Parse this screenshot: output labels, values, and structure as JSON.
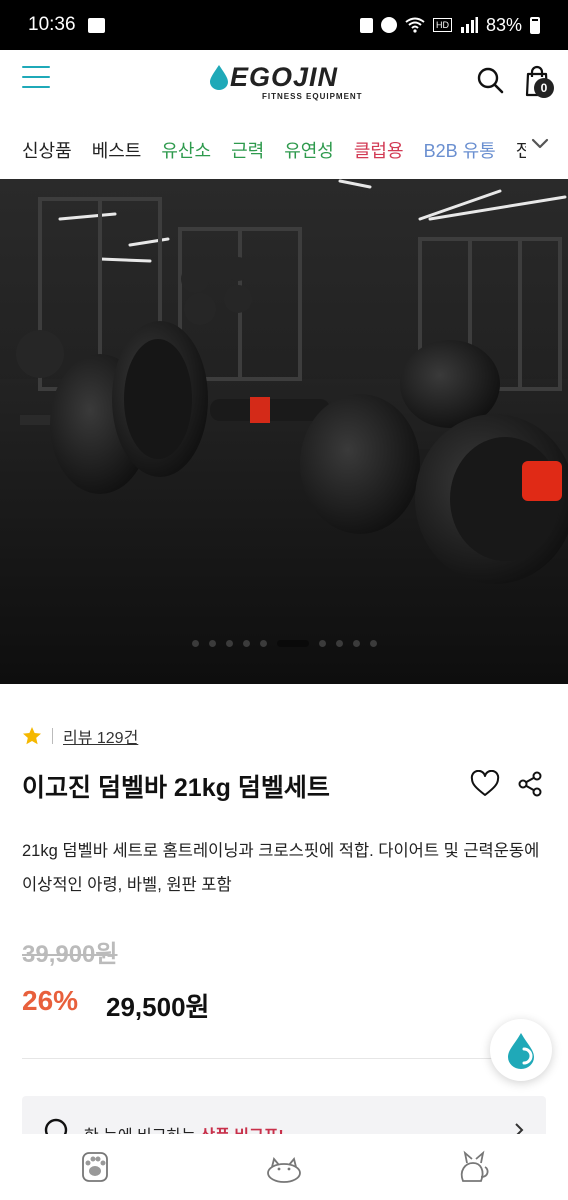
{
  "status": {
    "time": "10:36",
    "battery": "83%",
    "icons": [
      "image-icon",
      "lock-icon",
      "alarm-icon",
      "wifi-icon",
      "volte-icon",
      "signal-icon",
      "battery-icon"
    ]
  },
  "header": {
    "brand": "EGOJIN",
    "brand_sub": "FITNESS EQUIPMENT",
    "cart_count": "0",
    "accent": "#1fa9b8"
  },
  "categories": [
    {
      "label": "신상품",
      "color": "#222222"
    },
    {
      "label": "베스트",
      "color": "#222222"
    },
    {
      "label": "유산소",
      "color": "#2e9a4d"
    },
    {
      "label": "근력",
      "color": "#2e9a4d"
    },
    {
      "label": "유연성",
      "color": "#2e9a4d"
    },
    {
      "label": "클럽용",
      "color": "#d23a54"
    },
    {
      "label": "B2B 유통",
      "color": "#6a8fd0"
    },
    {
      "label": "전.",
      "color": "#222222"
    }
  ],
  "carousel": {
    "slide_count": 10,
    "active_index": 5
  },
  "product": {
    "review_text": "리뷰 129건",
    "title": "이고진 덤벨바 21kg 덤벨세트",
    "description": "21kg 덤벨바 세트로 홈트레이닝과 크로스핏에 적합. 다이어트 및 근력운동에 이상적인 아령, 바벨, 원판 포함",
    "original_price": "39,900원",
    "discount": "26%",
    "price": "29,500원"
  },
  "compare": {
    "text_before": "한 눈에 비교하는 ",
    "highlight": "상품 비교표!"
  },
  "bottom_nav": [
    "paw-icon",
    "cat-sleeping-icon",
    "cat-icon"
  ]
}
